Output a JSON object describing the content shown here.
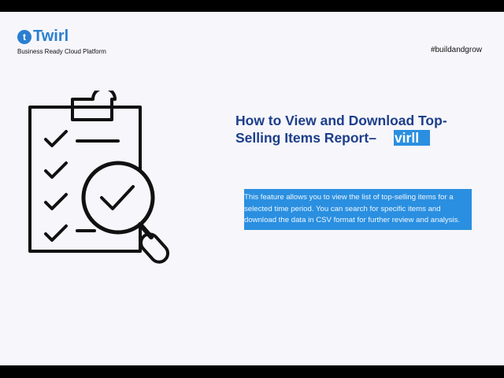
{
  "brand": {
    "logo_text": "Twirl",
    "tagline": "Business Ready Cloud Platform"
  },
  "hashtag": "#buildandgrow",
  "title": {
    "main": "How to View and Download Top-Selling Items Report–",
    "highlight": "virll"
  },
  "description": "This feature allows you to view the list of top-selling items for a selected time period. You can search for specific items and download the data in CSV format for further review and analysis.",
  "colors": {
    "accent": "#2a8fe0",
    "title": "#1d3e8a"
  }
}
